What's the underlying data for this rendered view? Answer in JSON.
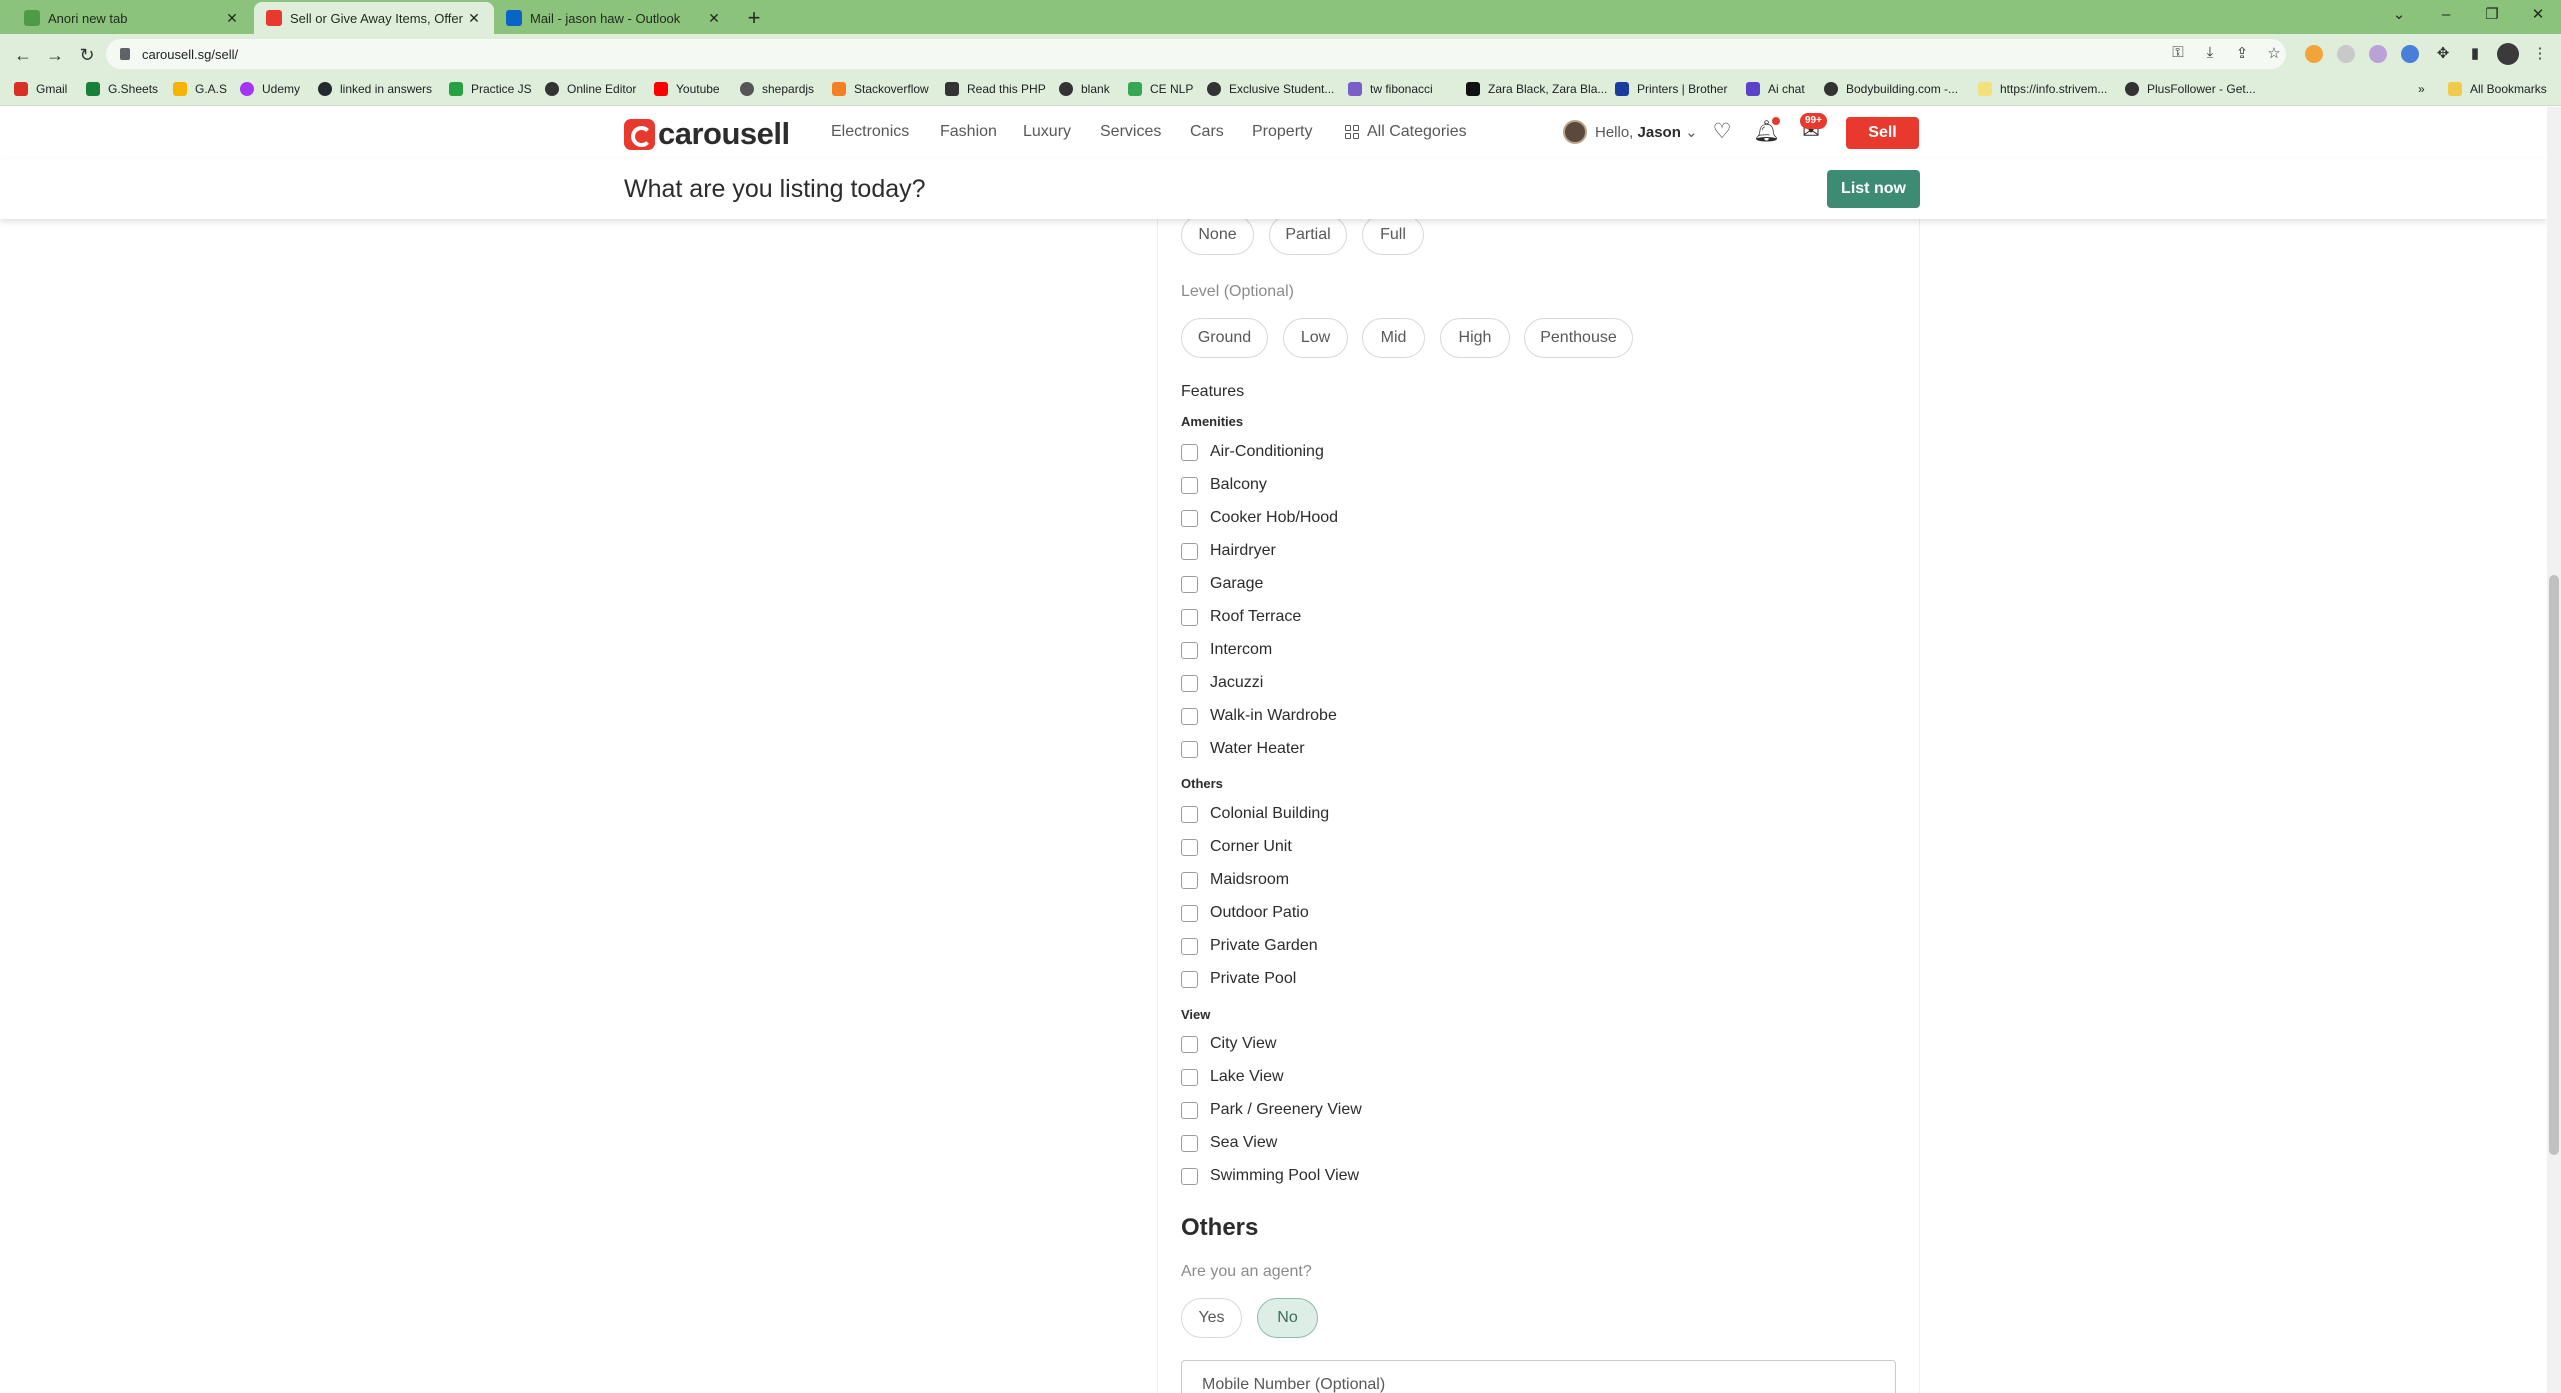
{
  "browser": {
    "tabs": [
      {
        "title": "Anori new tab"
      },
      {
        "title": "Sell or Give Away Items, Offer Se"
      },
      {
        "title": "Mail - jason haw - Outlook"
      }
    ],
    "url": "carousell.sg/sell/",
    "bookmarks": [
      "Gmail",
      "G.Sheets",
      "G.A.S",
      "Udemy",
      "linked in answers",
      "Practice JS",
      "Online Editor",
      "Youtube",
      "shepardjs",
      "Stackoverflow",
      "Read this PHP",
      "blank",
      "CE NLP",
      "Exclusive Student...",
      "tw fibonacci",
      "Zara Black, Zara Bla...",
      "Printers | Brother",
      "Ai chat",
      "Bodybuilding.com -...",
      "https://info.strivem...",
      "PlusFollower - Get..."
    ],
    "all_bookmarks": "All Bookmarks"
  },
  "site": {
    "logo": "carousell",
    "categories": [
      "Electronics",
      "Fashion",
      "Luxury",
      "Services",
      "Cars",
      "Property"
    ],
    "all_categories": "All Categories",
    "hello": "Hello,",
    "user": "Jason",
    "notif_badge": "99+",
    "sell": "Sell",
    "listing_title": "What are you listing today?",
    "list_now": "List now"
  },
  "form": {
    "furnishing_options": [
      "None",
      "Partial",
      "Full"
    ],
    "level_label": "Level (Optional)",
    "level_options": [
      "Ground",
      "Low",
      "Mid",
      "High",
      "Penthouse"
    ],
    "features_label": "Features",
    "amenities_label": "Amenities",
    "amenities": [
      "Air-Conditioning",
      "Balcony",
      "Cooker Hob/Hood",
      "Hairdryer",
      "Garage",
      "Roof Terrace",
      "Intercom",
      "Jacuzzi",
      "Walk-in Wardrobe",
      "Water Heater"
    ],
    "others_label": "Others",
    "others": [
      "Colonial Building",
      "Corner Unit",
      "Maidsroom",
      "Outdoor Patio",
      "Private Garden",
      "Private Pool"
    ],
    "view_label": "View",
    "views": [
      "City View",
      "Lake View",
      "Park / Greenery View",
      "Sea View",
      "Swimming Pool View"
    ],
    "others_section_title": "Others",
    "agent_question": "Are you an agent?",
    "agent_options": [
      "Yes",
      "No"
    ],
    "agent_selected": "No",
    "mobile_placeholder": "Mobile Number (Optional)"
  },
  "colors": {
    "brand_red": "#e8392e",
    "accent_green": "#3d8b73",
    "chrome_green": "#8bc27c"
  }
}
